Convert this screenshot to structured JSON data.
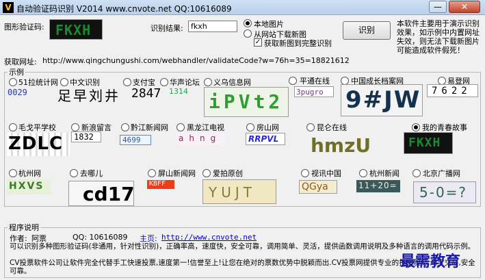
{
  "window": {
    "title": "自动验证码识别 V2014   www.cnvote.net    QQ:10616089",
    "icon": "V",
    "minimize_glyph": "—",
    "close_glyph": "✕"
  },
  "top": {
    "captcha_label": "图形验证码:",
    "current_captcha_text": "FKXH",
    "result_label": "识别结果:",
    "result_value": "fkxh",
    "source_local": "本地图片",
    "source_web": "从网站下载新图",
    "fetch_new_full": "获取新图到完整识别",
    "recognize_button": "识别",
    "notice": "本软件主要用于演示识别效果，如示例中内置网址失效，则无法下载新图片可能造成软件假死！",
    "url_label": "获取网址:",
    "url_value": "http://www.qingchungushi.com/webhandler/validateCode?w=76h=35=18821612"
  },
  "examples": {
    "legend": "示例",
    "selected": "我的青春故事",
    "items": [
      {
        "label": "51拉统计网",
        "captcha": "0029"
      },
      {
        "label": "中文识别",
        "captcha": "足早刘井"
      },
      {
        "label": "支付宝",
        "captcha": "2847"
      },
      {
        "label": "华声论坛",
        "captcha": "1314"
      },
      {
        "label": "义乌信息网",
        "captcha": "iPVt2"
      },
      {
        "label": "平通在线",
        "captcha": "3pugro"
      },
      {
        "label": "中国成长档案网",
        "captcha": "9#JW"
      },
      {
        "label": "易登网",
        "captcha": "7622"
      },
      {
        "label": "毛戈平学校",
        "captcha": "ZDLC"
      },
      {
        "label": "新浪留言",
        "captcha": "1832"
      },
      {
        "label": "黔江新闻网",
        "captcha": "4699"
      },
      {
        "label": "黑龙江电视",
        "captcha": "ahng"
      },
      {
        "label": "房山网",
        "captcha": "RRPVL"
      },
      {
        "label": "昆仑在线",
        "captcha": "hmzU"
      },
      {
        "label": "我的青春故事",
        "captcha": "FKXH"
      },
      {
        "label": "杭州网",
        "captcha": "HXVS"
      },
      {
        "label": "去哪儿",
        "captcha": "cd17"
      },
      {
        "label": "屏山新闻网",
        "captcha": "KBFF"
      },
      {
        "label": "爱拍原创",
        "captcha": "YUJT"
      },
      {
        "label": "视讯中国",
        "captcha": "QGya"
      },
      {
        "label": "杭州新闻",
        "captcha": "11+20="
      },
      {
        "label": "北京广播网",
        "captcha": "5-0=?"
      }
    ]
  },
  "program": {
    "legend": "程序说明",
    "author_label": "作者:",
    "author": "阿票",
    "qq": "QQ: 10616089",
    "homepage_label": "主页:",
    "homepage": "http://www.cnvote.net",
    "desc1": "可以识别多种图形验证码(非通用，针对性识别)，正确率高，速度快，安全可靠，调用简单、灵活，提供函数调用说明及多种语言的调用代码示例。",
    "desc2": "CV投票软件公司让软件完全代替手工快速投票,速度第一!信誉至上!让您在绝对的票数优势中脱颖而出.CV投票网提供专业的投票服务,淘宝交易,安全可靠。"
  },
  "watermark": "最需教育",
  "colors": {
    "titlebar": "#c6d9f0",
    "link": "#0000cc",
    "watermark": "#1a1aa6",
    "captcha_dark": "#000000",
    "captcha_green": "#1c8a2e"
  }
}
